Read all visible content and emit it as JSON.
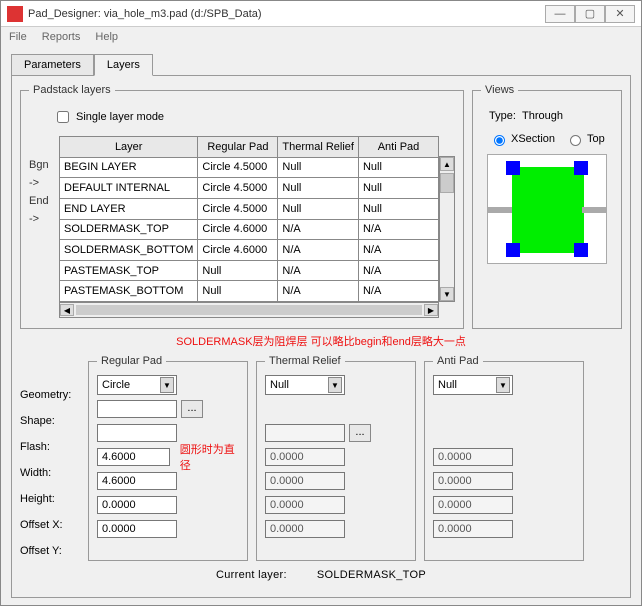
{
  "window": {
    "title": "Pad_Designer: via_hole_m3.pad (d:/SPB_Data)",
    "min": "—",
    "max": "▢",
    "close": "✕"
  },
  "menu": {
    "file": "File",
    "reports": "Reports",
    "help": "Help"
  },
  "tabs": {
    "parameters": "Parameters",
    "layers": "Layers"
  },
  "padstack": {
    "legend": "Padstack layers",
    "single_mode": "Single layer mode",
    "headers": {
      "layer": "Layer",
      "reg": "Regular Pad",
      "thermal": "Thermal Relief",
      "anti": "Anti Pad"
    },
    "rowlabels": [
      "Bgn",
      "->",
      "End",
      "->",
      "",
      "",
      ""
    ],
    "rows": [
      {
        "layer": "BEGIN LAYER",
        "reg": "Circle 4.5000",
        "th": "Null",
        "an": "Null"
      },
      {
        "layer": "DEFAULT INTERNAL",
        "reg": "Circle 4.5000",
        "th": "Null",
        "an": "Null"
      },
      {
        "layer": "END LAYER",
        "reg": "Circle 4.5000",
        "th": "Null",
        "an": "Null"
      },
      {
        "layer": "SOLDERMASK_TOP",
        "reg": "Circle 4.6000",
        "th": "N/A",
        "an": "N/A"
      },
      {
        "layer": "SOLDERMASK_BOTTOM",
        "reg": "Circle 4.6000",
        "th": "N/A",
        "an": "N/A"
      },
      {
        "layer": "PASTEMASK_TOP",
        "reg": "Null",
        "th": "N/A",
        "an": "N/A"
      },
      {
        "layer": "PASTEMASK_BOTTOM",
        "reg": "Null",
        "th": "N/A",
        "an": "N/A"
      }
    ]
  },
  "annot1": "SOLDERMASK层为阻焊层 可以略比begin和end层略大一点",
  "annot2": "圆形时为直径",
  "views": {
    "legend": "Views",
    "type_label": "Type:",
    "type_value": "Through",
    "xsection": "XSection",
    "top": "Top"
  },
  "labels": {
    "geometry": "Geometry:",
    "shape": "Shape:",
    "flash": "Flash:",
    "width": "Width:",
    "height": "Height:",
    "offx": "Offset X:",
    "offy": "Offset Y:"
  },
  "regular": {
    "legend": "Regular Pad",
    "geometry": "Circle",
    "shape": "",
    "flash": "",
    "width": "4.6000",
    "height": "4.6000",
    "offx": "0.0000",
    "offy": "0.0000"
  },
  "thermal": {
    "legend": "Thermal Relief",
    "geometry": "Null",
    "flash": "",
    "width": "0.0000",
    "height": "0.0000",
    "offx": "0.0000",
    "offy": "0.0000"
  },
  "anti": {
    "legend": "Anti Pad",
    "geometry": "Null",
    "width": "0.0000",
    "height": "0.0000",
    "offx": "0.0000",
    "offy": "0.0000"
  },
  "bottom": {
    "label": "Current layer:",
    "value": "SOLDERMASK_TOP"
  }
}
